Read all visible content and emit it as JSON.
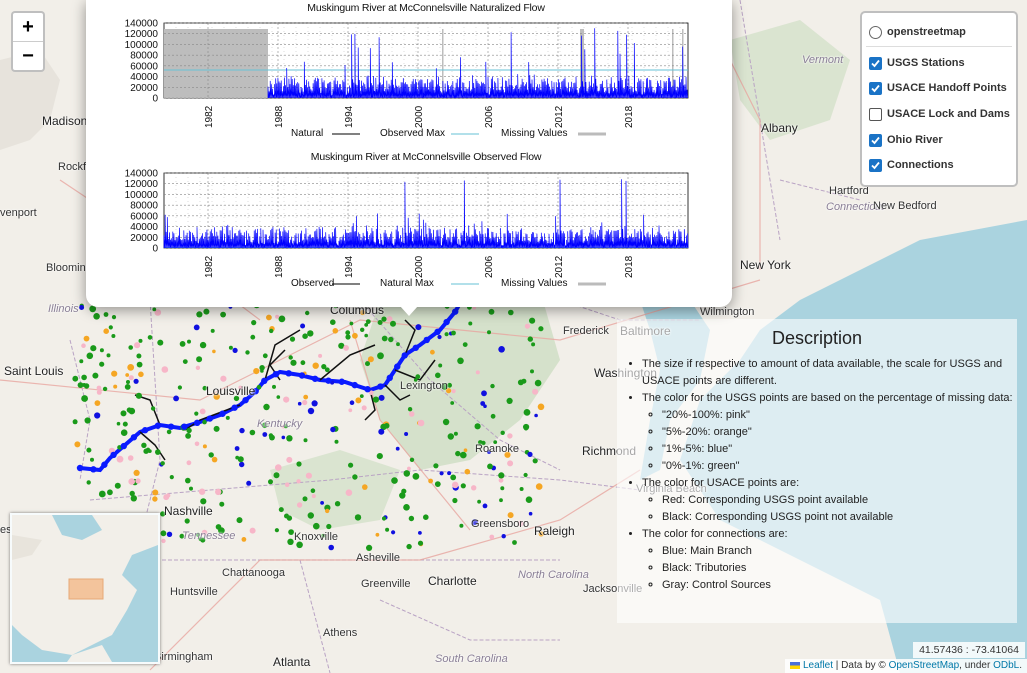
{
  "map": {
    "labels": [
      {
        "text": "Madison",
        "x": 42,
        "y": 121,
        "cls": "big"
      },
      {
        "text": "Rockford",
        "x": 58,
        "y": 168,
        "cls": ""
      },
      {
        "text": "venport",
        "x": 0,
        "y": 214,
        "cls": ""
      },
      {
        "text": "Bloomington",
        "x": 46,
        "y": 269,
        "cls": ""
      },
      {
        "text": "Illinois",
        "x": 48,
        "y": 310,
        "cls": "state"
      },
      {
        "text": "Saint Louis",
        "x": 4,
        "y": 371,
        "cls": "big"
      },
      {
        "text": "Columbus",
        "x": 330,
        "y": 310,
        "cls": "big"
      },
      {
        "text": "Louisville",
        "x": 206,
        "y": 391,
        "cls": "big"
      },
      {
        "text": "Kentucky",
        "x": 257,
        "y": 425,
        "cls": "state"
      },
      {
        "text": "Baltimore",
        "x": 620,
        "y": 331,
        "cls": "big"
      },
      {
        "text": "Frederick",
        "x": 563,
        "y": 332,
        "cls": ""
      },
      {
        "text": "Washington",
        "x": 594,
        "y": 373,
        "cls": "big"
      },
      {
        "text": "Richmond",
        "x": 582,
        "y": 451,
        "cls": "big"
      },
      {
        "text": "Virginia Beach",
        "x": 636,
        "y": 490,
        "cls": ""
      },
      {
        "text": "Roanoke",
        "x": 475,
        "y": 450,
        "cls": ""
      },
      {
        "text": "Greensboro",
        "x": 471,
        "y": 525,
        "cls": ""
      },
      {
        "text": "Raleigh",
        "x": 534,
        "y": 531,
        "cls": "big"
      },
      {
        "text": "Nashville",
        "x": 164,
        "y": 511,
        "cls": "big"
      },
      {
        "text": "Tennessee",
        "x": 182,
        "y": 537,
        "cls": "state"
      },
      {
        "text": "Knoxville",
        "x": 294,
        "y": 538,
        "cls": ""
      },
      {
        "text": "Asheville",
        "x": 356,
        "y": 559,
        "cls": ""
      },
      {
        "text": "Charlotte",
        "x": 428,
        "y": 581,
        "cls": "big"
      },
      {
        "text": "North Carolina",
        "x": 518,
        "y": 576,
        "cls": "state"
      },
      {
        "text": "Chattanooga",
        "x": 222,
        "y": 574,
        "cls": ""
      },
      {
        "text": "Huntsville",
        "x": 170,
        "y": 593,
        "cls": ""
      },
      {
        "text": "Greenville",
        "x": 361,
        "y": 585,
        "cls": ""
      },
      {
        "text": "Jacksonville",
        "x": 583,
        "y": 590,
        "cls": ""
      },
      {
        "text": "Athens",
        "x": 323,
        "y": 634,
        "cls": ""
      },
      {
        "text": "Birmingham",
        "x": 154,
        "y": 658,
        "cls": ""
      },
      {
        "text": "Atlanta",
        "x": 273,
        "y": 662,
        "cls": "big"
      },
      {
        "text": "South Carolina",
        "x": 435,
        "y": 660,
        "cls": "state"
      },
      {
        "text": "Vermont",
        "x": 802,
        "y": 61,
        "cls": "state"
      },
      {
        "text": "Albany",
        "x": 761,
        "y": 128,
        "cls": "big"
      },
      {
        "text": "Hartford",
        "x": 829,
        "y": 192,
        "cls": ""
      },
      {
        "text": "Connecticut",
        "x": 826,
        "y": 208,
        "cls": "state"
      },
      {
        "text": "New Bedford",
        "x": 873,
        "y": 207,
        "cls": ""
      },
      {
        "text": "New York",
        "x": 740,
        "y": 265,
        "cls": "big"
      },
      {
        "text": "Wilmington",
        "x": 700,
        "y": 313,
        "cls": ""
      },
      {
        "text": "esi",
        "x": 0,
        "y": 531,
        "cls": ""
      },
      {
        "text": "Lexington",
        "x": 400,
        "y": 387,
        "cls": ""
      }
    ]
  },
  "zoom": {
    "in_label": "+",
    "out_label": "−"
  },
  "popup": {
    "charts": [
      {
        "title": "Muskingum River at McConnelsville Naturalized Flow",
        "y_ticks": [
          "140000",
          "120000",
          "100000",
          "80000",
          "60000",
          "40000",
          "20000",
          "0"
        ],
        "x_ticks": [
          "1982",
          "1988",
          "1994",
          "2000",
          "2006",
          "2012",
          "2018"
        ],
        "legend": [
          {
            "label": "Natural",
            "color": "#000000"
          },
          {
            "label": "Observed Max",
            "color": "#66c2d6"
          },
          {
            "label": "Missing Values",
            "color": "#bbbbbb"
          }
        ]
      },
      {
        "title": "Muskingum River at McConnelsville Observed Flow",
        "y_ticks": [
          "140000",
          "120000",
          "100000",
          "80000",
          "60000",
          "40000",
          "20000",
          "0"
        ],
        "x_ticks": [
          "1982",
          "1988",
          "1994",
          "2000",
          "2006",
          "2012",
          "2018"
        ],
        "legend": [
          {
            "label": "Observed",
            "color": "#000000"
          },
          {
            "label": "Natural Max",
            "color": "#66c2d6"
          },
          {
            "label": "Missing Values",
            "color": "#bbbbbb"
          }
        ]
      }
    ]
  },
  "layers": {
    "base": {
      "label": "openstreetmap",
      "selected": false
    },
    "overlays": [
      {
        "label": "USGS Stations",
        "checked": true
      },
      {
        "label": "USACE Handoff Points",
        "checked": true
      },
      {
        "label": "USACE Lock and Dams",
        "checked": false
      },
      {
        "label": "Ohio River",
        "checked": true
      },
      {
        "label": "Connections",
        "checked": true
      }
    ]
  },
  "description": {
    "title": "Description",
    "item1": "The size if respective to amount of data available, the scale for USGS and USACE points are different.",
    "item2": "The color for the USGS points are based on the percentage of missing data:",
    "item2_sub": [
      "\"20%-100%: pink\"",
      "\"5%-20%: orange\"",
      "\"1%-5%: blue\"",
      "\"0%-1%: green\""
    ],
    "item3": "The color for USACE points are:",
    "item3_sub": [
      "Red: Corresponding USGS point available",
      "Black: Corresponding USGS point not available"
    ],
    "item4": "The color for connections are:",
    "item4_sub": [
      "Blue: Main Branch",
      "Black: Tributories",
      "Gray: Control Sources"
    ]
  },
  "coords": "41.57436 : -73.41064",
  "attribution": {
    "leaflet": "Leaflet",
    "data": " | Data by © ",
    "osm": "OpenStreetMap",
    "under": ", under ",
    "odbl": "ODbL",
    "end": "."
  },
  "colors": {
    "usgs_green": "#1a9a1a",
    "usgs_orange": "#f5a623",
    "usgs_blue": "#1010e0",
    "usgs_pink": "#f7b6c8",
    "river_blue": "#0a1aff",
    "flow_blue": "#0000ff"
  }
}
